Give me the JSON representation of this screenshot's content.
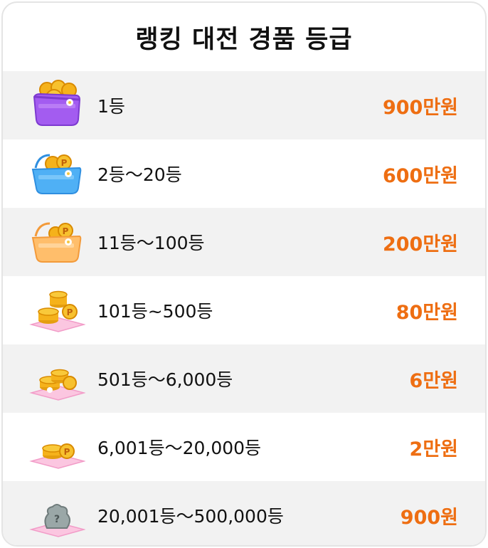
{
  "title": "랭킹 대전 경품 등급",
  "colors": {
    "prize": "#ee6e12",
    "row_alt": "#f2f2f2",
    "border": "#e4e4e4"
  },
  "tiers": [
    {
      "rank": "1등",
      "prize": "900만원",
      "icon": "purple-basket-coins-icon"
    },
    {
      "rank": "2등～20등",
      "prize": "600만원",
      "icon": "blue-basket-coins-icon"
    },
    {
      "rank": "11등～100등",
      "prize": "200만원",
      "icon": "orange-basket-coins-icon"
    },
    {
      "rank": "101등~500등",
      "prize": "80만원",
      "icon": "coin-stack-large-icon"
    },
    {
      "rank": "501등～6,000등",
      "prize": "6만원",
      "icon": "coin-stack-medium-icon"
    },
    {
      "rank": "6,001등～20,000등",
      "prize": "2만원",
      "icon": "coin-stack-small-icon"
    },
    {
      "rank": "20,001등～500,000등",
      "prize": "900원",
      "icon": "mystery-bag-icon"
    }
  ]
}
